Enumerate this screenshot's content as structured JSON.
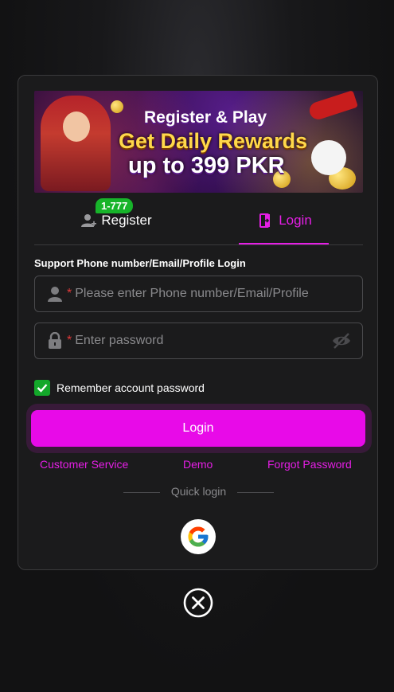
{
  "banner": {
    "line1": "Register & Play",
    "line2": "Get Daily Rewards",
    "line3": "up to 399 PKR"
  },
  "tabs": {
    "register_label": "Register",
    "register_badge": "1-777",
    "login_label": "Login",
    "active": "login"
  },
  "form": {
    "section_label": "Support Phone number/Email/Profile Login",
    "account_placeholder": "Please enter Phone number/Email/Profile",
    "password_placeholder": "Enter password",
    "required_mark": "*",
    "remember_label": "Remember account password",
    "remember_checked": true,
    "login_button": "Login"
  },
  "links": {
    "customer_service": "Customer Service",
    "demo": "Demo",
    "forgot_password": "Forgot Password"
  },
  "quick_login": {
    "label": "Quick login",
    "providers": [
      "google-icon"
    ]
  },
  "colors": {
    "accent": "#e80ae8",
    "badge": "#17b42a",
    "background": "#111112",
    "panel": "#1b1b1c"
  },
  "icons": [
    "user-icon",
    "lock-icon",
    "eye-slash-icon",
    "check-icon",
    "google-icon",
    "close-icon",
    "register-user-icon",
    "login-door-icon"
  ]
}
